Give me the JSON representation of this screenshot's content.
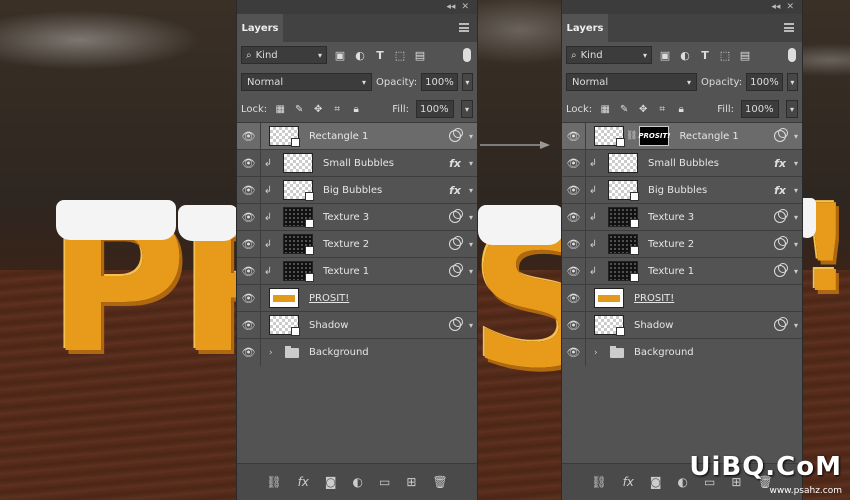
{
  "panels": [
    {
      "tab_label": "Layers",
      "filter": {
        "value": "Kind"
      },
      "blend_mode": "Normal",
      "opacity_label": "Opacity:",
      "opacity_value": "100%",
      "lock_label": "Lock:",
      "fill_label": "Fill:",
      "fill_value": "100%",
      "layers": [
        {
          "name": "Rectangle 1",
          "selected": true
        },
        {
          "name": "Small Bubbles"
        },
        {
          "name": "Big Bubbles"
        },
        {
          "name": "Texture 3"
        },
        {
          "name": "Texture 2"
        },
        {
          "name": "Texture 1"
        },
        {
          "name": "PROSIT!"
        },
        {
          "name": "Shadow"
        },
        {
          "name": "Background"
        }
      ]
    },
    {
      "tab_label": "Layers",
      "filter": {
        "value": "Kind"
      },
      "blend_mode": "Normal",
      "opacity_label": "Opacity:",
      "opacity_value": "100%",
      "lock_label": "Lock:",
      "fill_label": "Fill:",
      "fill_value": "100%",
      "mask_text": "PROSIT!",
      "layers": [
        {
          "name": "Rectangle 1",
          "selected": true
        },
        {
          "name": "Small Bubbles"
        },
        {
          "name": "Big Bubbles"
        },
        {
          "name": "Texture 3"
        },
        {
          "name": "Texture 2"
        },
        {
          "name": "Texture 1"
        },
        {
          "name": "PROSIT!"
        },
        {
          "name": "Shadow"
        },
        {
          "name": "Background"
        }
      ]
    }
  ],
  "background_letters": [
    "P",
    "R",
    "S",
    "!"
  ],
  "watermark": {
    "main": "UiBQ.CoM",
    "sub": "www.psahz.com"
  },
  "colors": {
    "panel": "#535353",
    "selected_row": "#6b6b6b",
    "letter": "#e89a1a"
  }
}
